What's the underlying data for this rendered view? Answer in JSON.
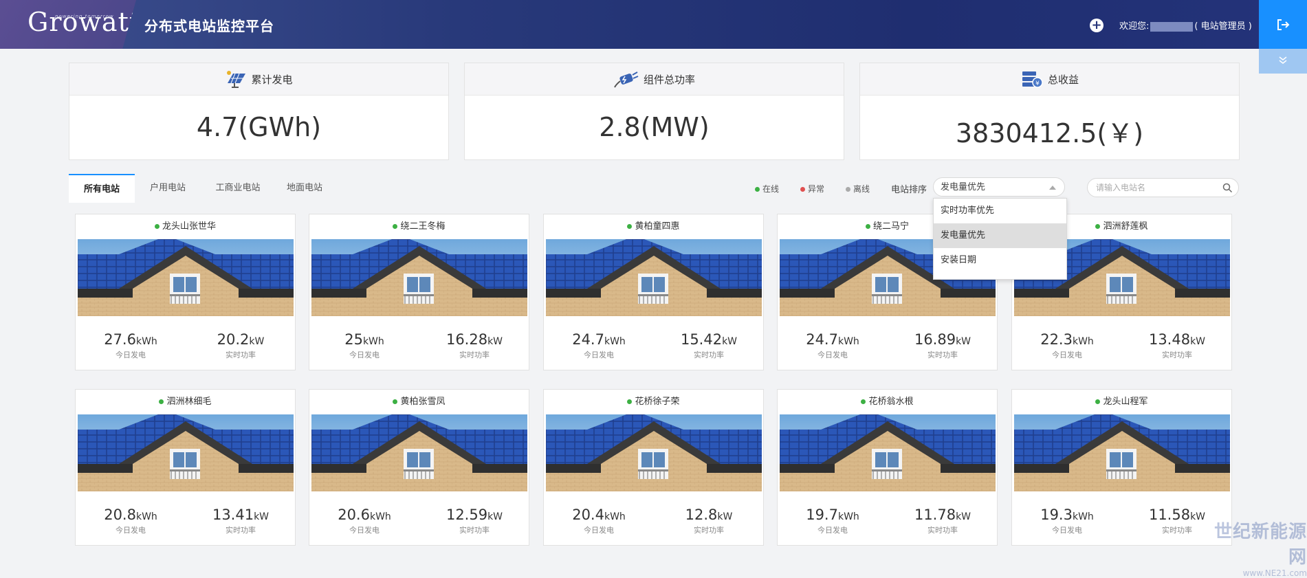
{
  "header": {
    "logo": "Growatt",
    "logo_tagline": "powering tomorrow",
    "app_title": "分布式电站监控平台",
    "welcome_prefix": "欢迎您:",
    "welcome_role": "( 电站管理员 )"
  },
  "stats": [
    {
      "label": "累计发电",
      "value": "4.7(GWh)",
      "icon": "solar-panel-icon"
    },
    {
      "label": "组件总功率",
      "value": "2.8(MW)",
      "icon": "power-plug-icon"
    },
    {
      "label": "总收益",
      "value": "3830412.5(￥)",
      "icon": "money-stack-icon"
    }
  ],
  "tabs": [
    "所有电站",
    "户用电站",
    "工商业电站",
    "地面电站"
  ],
  "active_tab": "所有电站",
  "legend": {
    "online": "在线",
    "online_color": "#3cb043",
    "error": "异常",
    "error_color": "#e05050",
    "offline": "离线",
    "offline_color": "#aaaaaa"
  },
  "sort": {
    "label": "电站排序",
    "selected": "发电量优先",
    "options": [
      "实时功率优先",
      "发电量优先",
      "安装日期"
    ]
  },
  "search": {
    "placeholder": "请输入电站名"
  },
  "metric_labels": {
    "today_energy": "今日发电",
    "realtime_power": "实时功率"
  },
  "stations": [
    {
      "name": "龙头山张世华",
      "energy": "27.6",
      "energy_unit": "kWh",
      "power": "20.2",
      "power_unit": "kW"
    },
    {
      "name": "绕二王冬梅",
      "energy": "25",
      "energy_unit": "kWh",
      "power": "16.28",
      "power_unit": "kW"
    },
    {
      "name": "黄柏童四惠",
      "energy": "24.7",
      "energy_unit": "kWh",
      "power": "15.42",
      "power_unit": "kW"
    },
    {
      "name": "绕二马宁",
      "energy": "24.7",
      "energy_unit": "kWh",
      "power": "16.89",
      "power_unit": "kW"
    },
    {
      "name": "泗洲舒莲枫",
      "energy": "22.3",
      "energy_unit": "kWh",
      "power": "13.48",
      "power_unit": "kW"
    },
    {
      "name": "泗洲林细毛",
      "energy": "20.8",
      "energy_unit": "kWh",
      "power": "13.41",
      "power_unit": "kW"
    },
    {
      "name": "黄柏张雪凤",
      "energy": "20.6",
      "energy_unit": "kWh",
      "power": "12.59",
      "power_unit": "kW"
    },
    {
      "name": "花桥徐子荣",
      "energy": "20.4",
      "energy_unit": "kWh",
      "power": "12.8",
      "power_unit": "kW"
    },
    {
      "name": "花桥翁水根",
      "energy": "19.7",
      "energy_unit": "kWh",
      "power": "11.78",
      "power_unit": "kW"
    },
    {
      "name": "龙头山程军",
      "energy": "19.3",
      "energy_unit": "kWh",
      "power": "11.58",
      "power_unit": "kW"
    }
  ],
  "watermark": {
    "line1": "世纪新能源网",
    "line2": "www.NE21.com"
  }
}
